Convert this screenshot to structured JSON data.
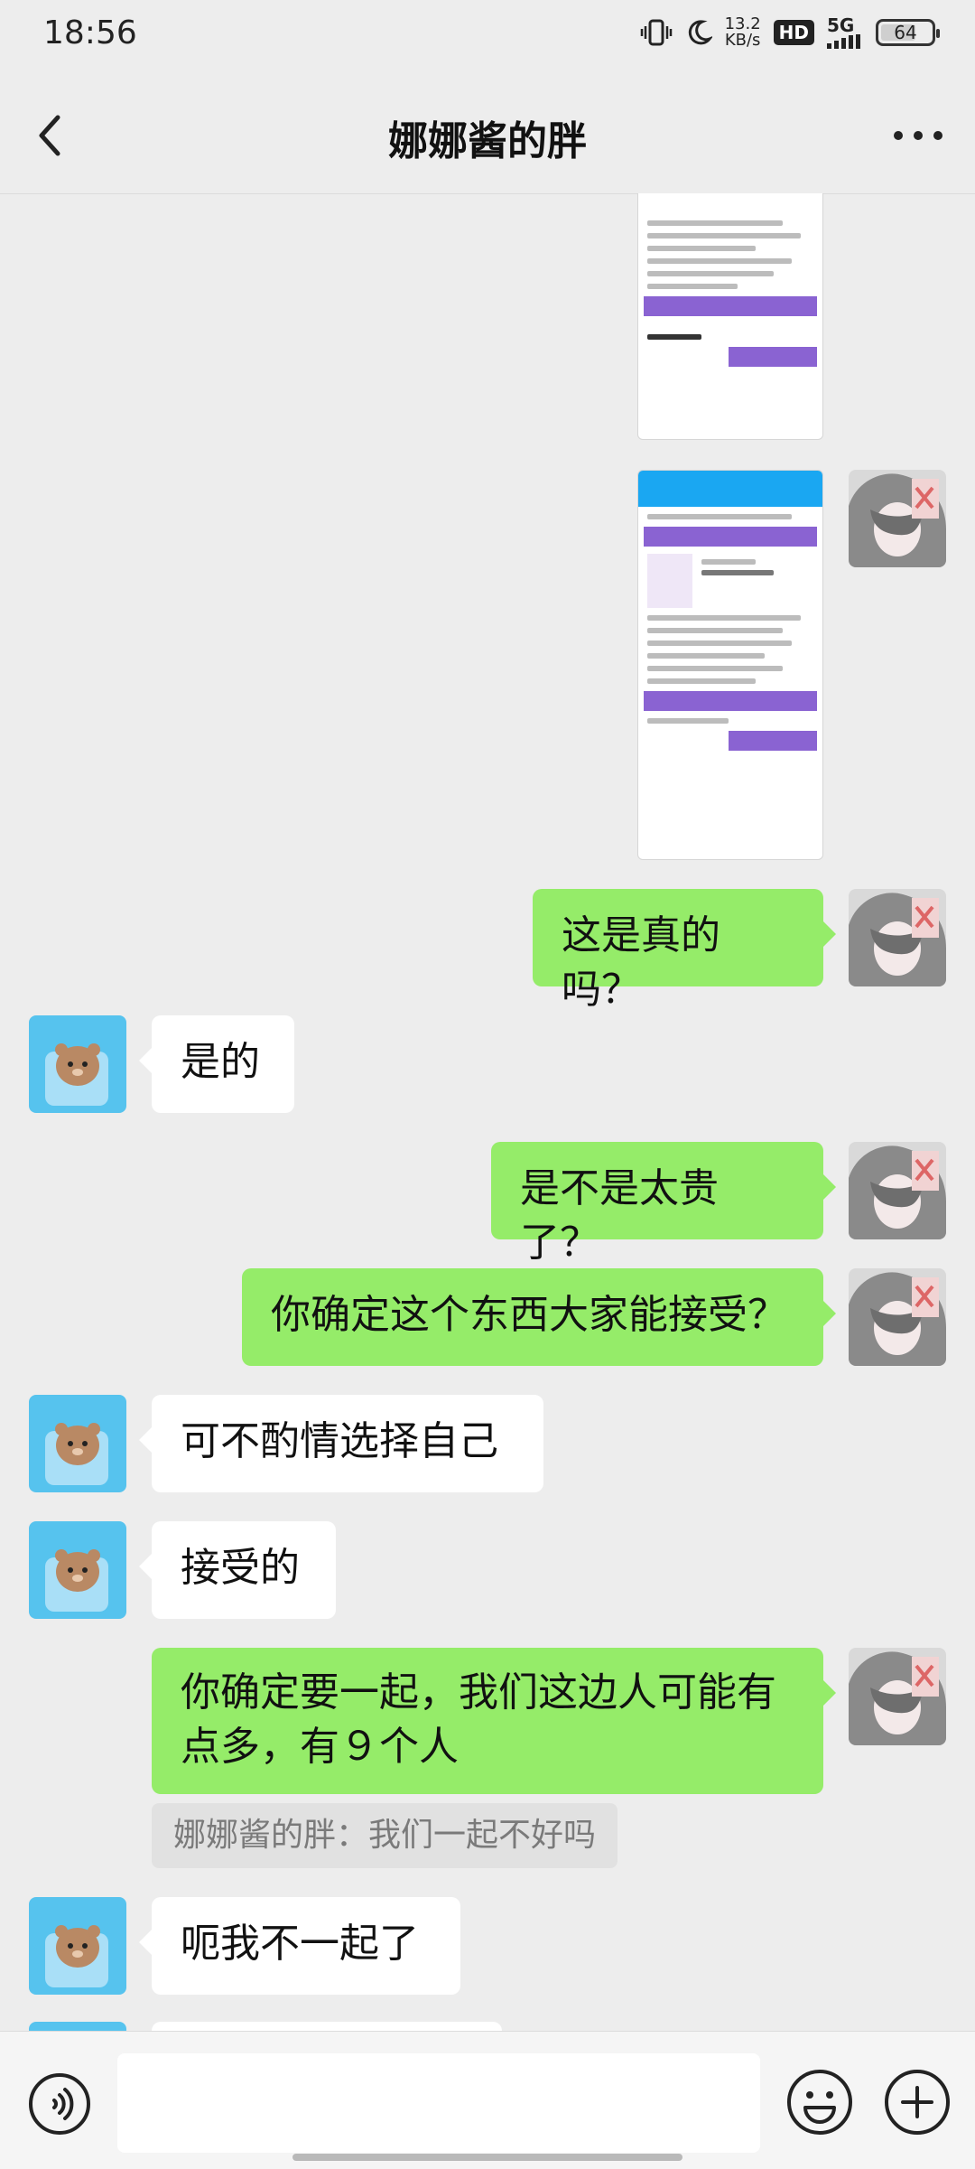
{
  "status": {
    "time": "18:56",
    "speed_value": "13.2",
    "speed_unit": "KB/s",
    "hd": "HD",
    "network": "5G",
    "battery": "64"
  },
  "header": {
    "title": "娜娜酱的胖"
  },
  "messages": [
    {
      "text": "这是真的吗？"
    },
    {
      "text": "是的"
    },
    {
      "text": "是不是太贵了？"
    },
    {
      "text": "你确定这个东西大家能接受？"
    },
    {
      "text": "可不酌情选择自己"
    },
    {
      "text": "接受的"
    },
    {
      "text": "你确定要一起，我们这边人可能有点多，有９个人"
    },
    {
      "text": "娜娜酱的胖：我们一起不好吗"
    },
    {
      "text": "呃我不一起了"
    }
  ],
  "composer": {
    "placeholder": ""
  },
  "colors": {
    "bubble_out": "#95ec69",
    "bubble_in": "#ffffff",
    "background": "#ededed"
  },
  "icons": {
    "back": "chevron-left-icon",
    "more": "more-dots-icon",
    "voice": "voice-icon",
    "emoji": "emoji-icon",
    "plus": "plus-icon"
  }
}
